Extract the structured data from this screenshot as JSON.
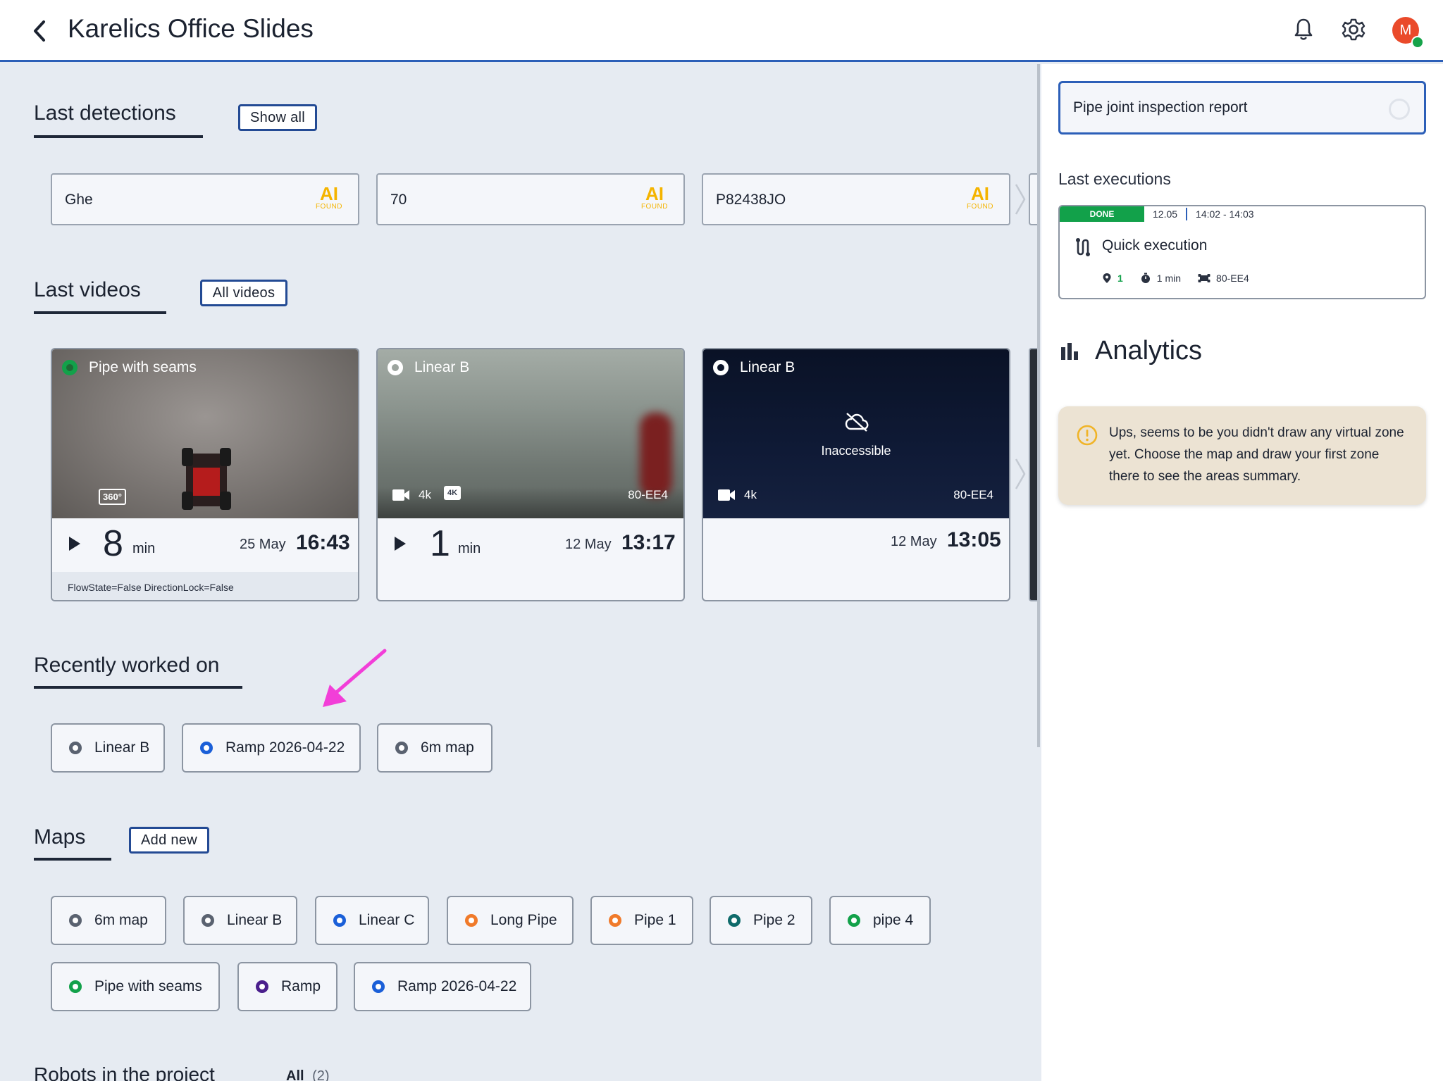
{
  "header": {
    "title": "Karelics Office Slides",
    "avatar_initial": "M",
    "accent_color": "#2c5fb8"
  },
  "last_detections": {
    "title": "Last detections",
    "show_all_label": "Show all",
    "items": [
      {
        "label": "Ghe",
        "badge": "AI",
        "badge_sub": "FOUND"
      },
      {
        "label": "70",
        "badge": "AI",
        "badge_sub": "FOUND"
      },
      {
        "label": "P82438JO",
        "badge": "AI",
        "badge_sub": "FOUND"
      }
    ]
  },
  "last_videos": {
    "title": "Last videos",
    "all_label": "All videos",
    "items": [
      {
        "name": "Pipe with seams",
        "badge": "360°",
        "duration": "8",
        "duration_unit": "min",
        "date": "25 May",
        "time": "16:43",
        "meta": "FlowState=False DirectionLock=False"
      },
      {
        "name": "Linear B",
        "quality": "4k",
        "quality_badge": "4K",
        "robot": "80-EE4",
        "duration": "1",
        "duration_unit": "min",
        "date": "12 May",
        "time": "13:17"
      },
      {
        "name": "Linear B",
        "status": "Inaccessible",
        "quality": "4k",
        "robot": "80-EE4",
        "date": "12 May",
        "time": "13:05"
      }
    ]
  },
  "recently_worked_on": {
    "title": "Recently worked on",
    "items": [
      {
        "label": "Linear B",
        "color": "#5a6270"
      },
      {
        "label": "Ramp 2026-04-22",
        "color": "#1a5fd8"
      },
      {
        "label": "6m map",
        "color": "#5a6270"
      }
    ]
  },
  "maps": {
    "title": "Maps",
    "add_label": "Add new",
    "items": [
      {
        "label": "6m map",
        "color": "#5a6270"
      },
      {
        "label": "Linear B",
        "color": "#5a6270"
      },
      {
        "label": "Linear C",
        "color": "#1a5fd8"
      },
      {
        "label": "Long Pipe",
        "color": "#f07a2a"
      },
      {
        "label": "Pipe 1",
        "color": "#f07a2a"
      },
      {
        "label": "Pipe 2",
        "color": "#0f6b6b"
      },
      {
        "label": "pipe 4",
        "color": "#12a14a"
      },
      {
        "label": "Pipe with seams",
        "color": "#12a14a"
      },
      {
        "label": "Ramp",
        "color": "#4a1f8c"
      },
      {
        "label": "Ramp 2026-04-22",
        "color": "#1a5fd8"
      }
    ]
  },
  "robots": {
    "title": "Robots in the project",
    "all_label": "All",
    "count": "(2)"
  },
  "right_panel": {
    "search_value": "Pipe joint inspection report",
    "last_executions_title": "Last executions",
    "execution": {
      "status": "DONE",
      "date": "12.05",
      "time_range": "14:02 - 14:03",
      "title": "Quick execution",
      "points": "1",
      "duration": "1 min",
      "robot": "80-EE4"
    },
    "analytics_title": "Analytics",
    "alert_text": "Ups, seems to be you didn't draw any virtual zone yet. Choose the map and draw your first zone there to see the areas summary."
  }
}
